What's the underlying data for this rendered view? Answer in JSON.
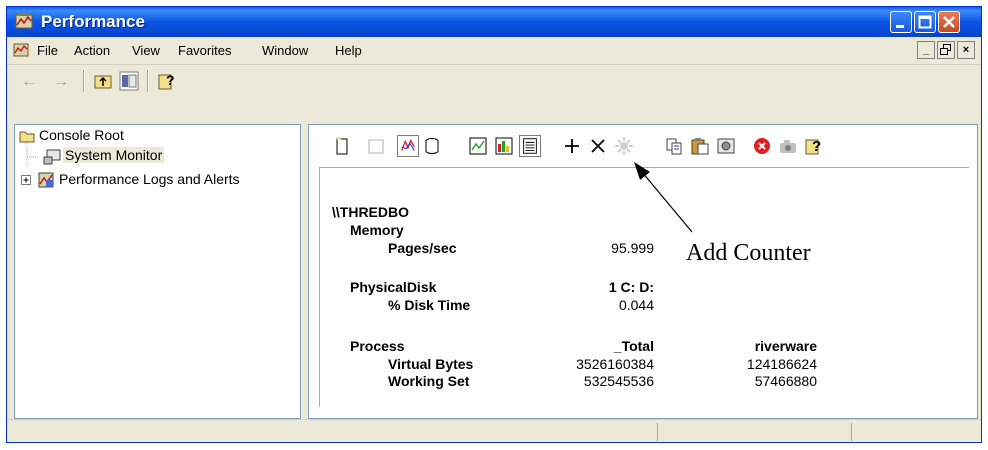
{
  "window": {
    "title": "Performance",
    "colors": {
      "titlebar": "#0a54e6",
      "face": "#ece9d8",
      "close_button": "#c84820"
    }
  },
  "menubar": {
    "items": [
      "File",
      "Action",
      "View",
      "Favorites",
      "Window",
      "Help"
    ],
    "mdi_buttons": [
      "_",
      "Ÿ",
      "×"
    ]
  },
  "toolbar": {
    "icons": [
      "back-arrow-icon",
      "forward-arrow-icon",
      "up-folder-icon",
      "show-hide-tree-icon",
      "help-icon"
    ]
  },
  "tree": {
    "root": "Console Root",
    "children": [
      {
        "label": "System Monitor",
        "expander": ""
      },
      {
        "label": "Performance Logs and Alerts",
        "expander": "+"
      }
    ]
  },
  "monitor_toolbar": {
    "icons": [
      "new-counter-set-icon",
      "clear-display-icon",
      "view-current-activity-icon",
      "view-log-data-icon",
      "view-graph-icon",
      "view-histogram-icon",
      "view-report-icon",
      "add-counter-icon",
      "delete-counter-icon",
      "highlight-icon",
      "copy-properties-icon",
      "paste-counter-list-icon",
      "properties-icon",
      "freeze-display-icon",
      "update-data-icon",
      "help-icon"
    ]
  },
  "report": {
    "machine": "\\\\THREDBO",
    "sections": [
      {
        "object": "Memory",
        "instances": [],
        "counters": [
          {
            "name": "Pages/sec",
            "values": [
              "95.999"
            ]
          }
        ]
      },
      {
        "object": "PhysicalDisk",
        "instances": [
          "1 C: D:"
        ],
        "counters": [
          {
            "name": "% Disk Time",
            "values": [
              "0.044"
            ]
          }
        ]
      },
      {
        "object": "Process",
        "instances": [
          "_Total",
          "riverware"
        ],
        "counters": [
          {
            "name": "Virtual Bytes",
            "values": [
              "3526160384",
              "124186624"
            ]
          },
          {
            "name": "Working Set",
            "values": [
              "532545536",
              "57466880"
            ]
          }
        ]
      }
    ]
  },
  "callout": {
    "label": "Add Counter"
  },
  "statusbar": {
    "segments": [
      "",
      "",
      ""
    ]
  }
}
